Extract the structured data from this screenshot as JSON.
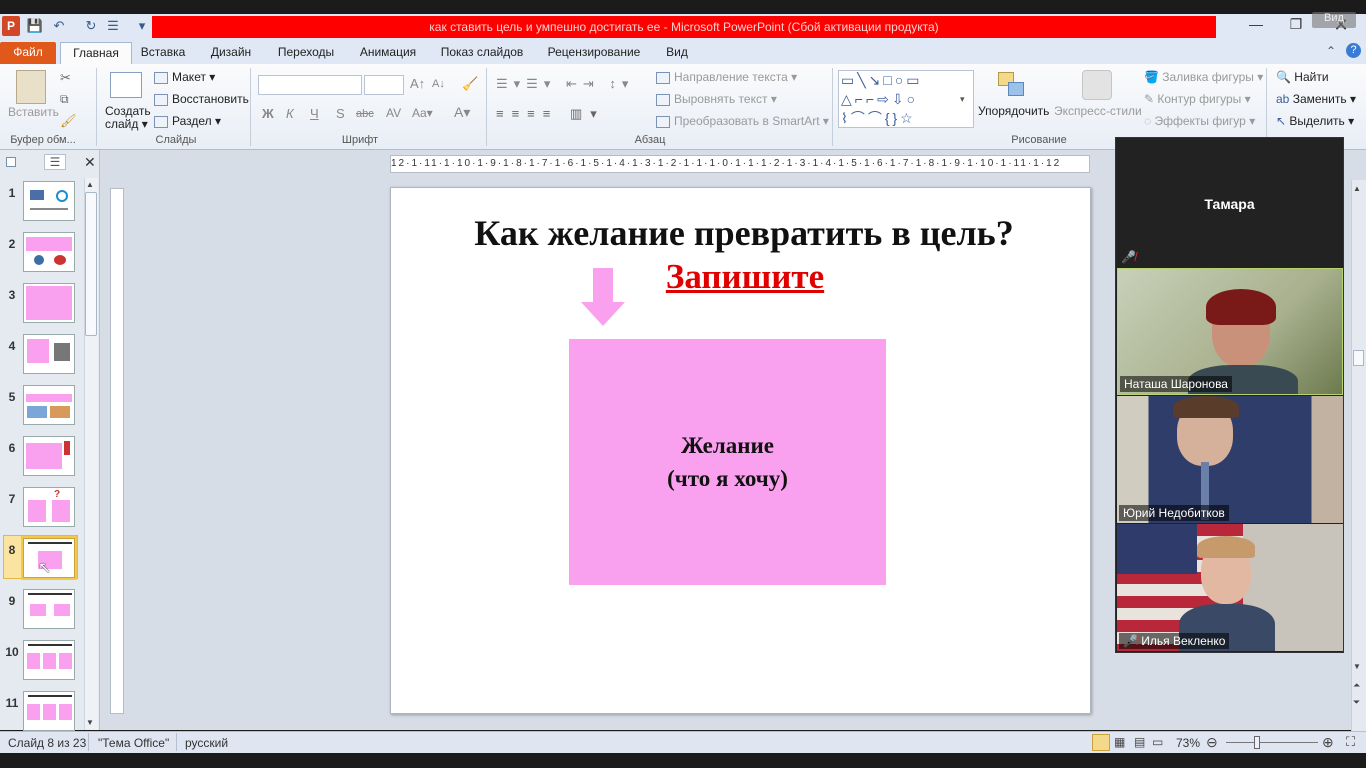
{
  "window": {
    "title": "как ставить цель и умпешно достигать ее  -  Microsoft PowerPoint (Сбой активации продукта)",
    "watermark": "Вид"
  },
  "ribbon_tabs": [
    "Файл",
    "Главная",
    "Вставка",
    "Дизайн",
    "Переходы",
    "Анимация",
    "Показ слайдов",
    "Рецензирование",
    "Вид"
  ],
  "clipboard": {
    "paste": "Вставить",
    "label": "Буфер обм..."
  },
  "slides_group": {
    "create": "Создать",
    "create2": "слайд",
    "layout": "Макет",
    "reset": "Восстановить",
    "section": "Раздел",
    "label": "Слайды"
  },
  "font_group": {
    "bold": "Ж",
    "italic": "К",
    "underline": "Ч",
    "strike": "abc",
    "shadow": "S",
    "label": "Шрифт"
  },
  "paragraph_group": {
    "text_dir": "Направление текста",
    "align_text": "Выровнять текст",
    "smartart": "Преобразовать в SmartArt",
    "label": "Абзац"
  },
  "drawing_group": {
    "arrange": "Упорядочить",
    "quick_styles": "Экспресс-стили",
    "fill": "Заливка фигуры",
    "outline": "Контур фигуры",
    "effects": "Эффекты фигур",
    "label": "Рисование"
  },
  "editing_group": {
    "find": "Найти",
    "replace": "Заменить",
    "select": "Выделить"
  },
  "thumbnails": [
    "1",
    "2",
    "3",
    "4",
    "5",
    "6",
    "7",
    "8",
    "9",
    "10",
    "11"
  ],
  "selected_slide": "8",
  "ruler": "12·1·11·1·10·1·9·1·8·1·7·1·6·1·5·1·4·1·3·1·2·1·1·1·0·1·1·1·2·1·3·1·4·1·5·1·6·1·7·1·8·1·9·1·10·1·11·1·12",
  "slide": {
    "title": "Как желание превратить в цель?",
    "subtitle": "Запишите",
    "box_line1": "Желание",
    "box_line2": "(что я хочу)"
  },
  "zoom": {
    "host": "Тамара",
    "participants": [
      "Наташа Шаронова",
      "Юрий Недобитков",
      "Илья Векленко"
    ]
  },
  "status": {
    "slide": "Слайд 8 из 23",
    "theme": "\"Тема Office\"",
    "language": "русский",
    "zoom": "73%"
  },
  "colors": {
    "accent": "#e0581a",
    "title_bar": "#ff0000",
    "slide_box": "#f9a0ee",
    "subtitle": "#e00000"
  }
}
